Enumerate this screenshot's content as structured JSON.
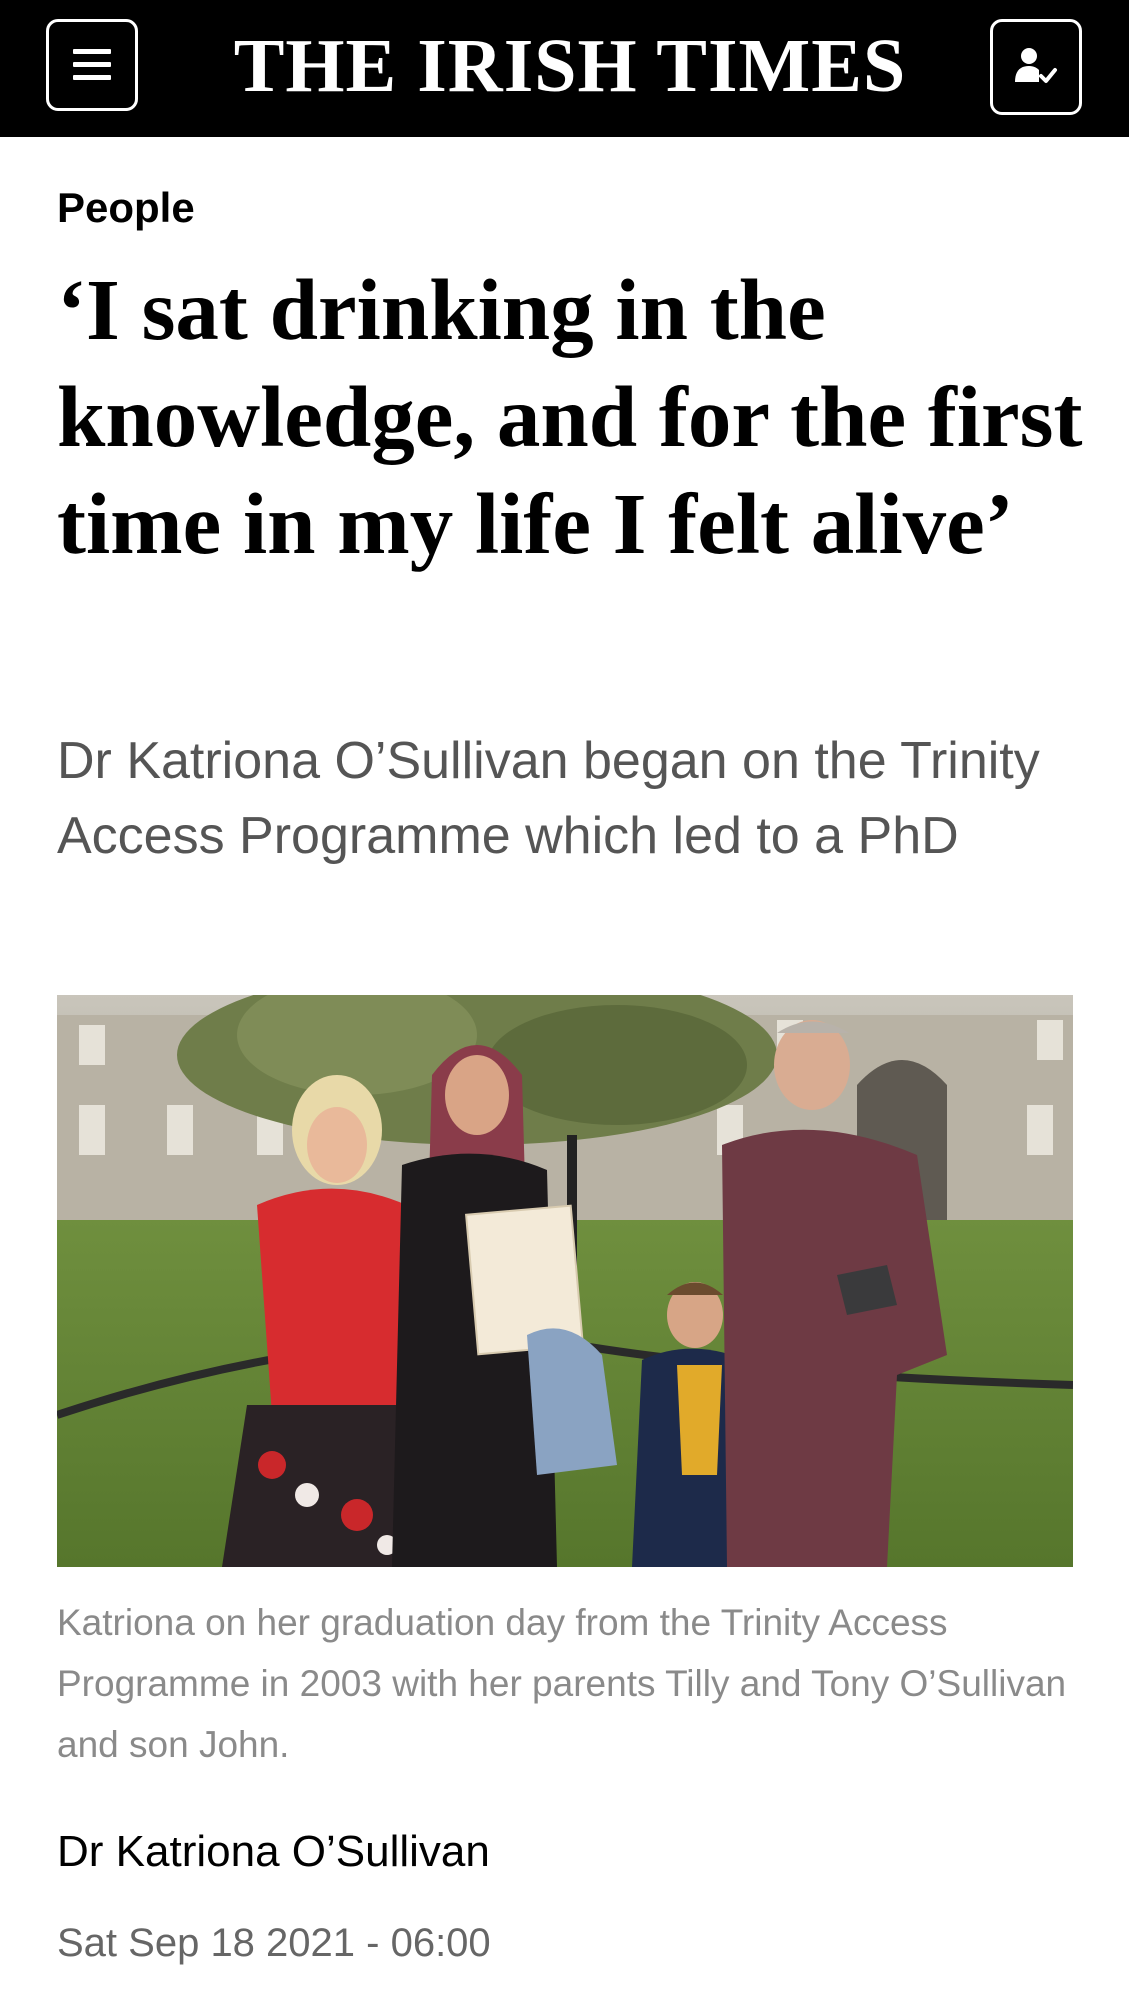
{
  "header": {
    "masthead": "THE IRISH TIMES",
    "menu_icon": "hamburger-menu-icon",
    "account_icon": "account-verified-icon",
    "background": "#000000"
  },
  "article": {
    "section": "People",
    "headline": "‘I sat drinking in the knowledge, and for the first time in my life I felt alive’",
    "standfirst": "Dr Katriona O’Sullivan began on the Trinity Access Programme which led to a PhD",
    "image_caption": "Katriona on her graduation day from the Trinity Access Programme in 2003 with her parents Tilly and Tony O’Sullivan and son John.",
    "author": "Dr Katriona O’Sullivan",
    "published": "Sat Sep 18 2021 - 06:00"
  },
  "colors": {
    "text_primary": "#000000",
    "text_standfirst": "#555555",
    "text_caption": "#8a8a8a",
    "text_date": "#666666"
  }
}
